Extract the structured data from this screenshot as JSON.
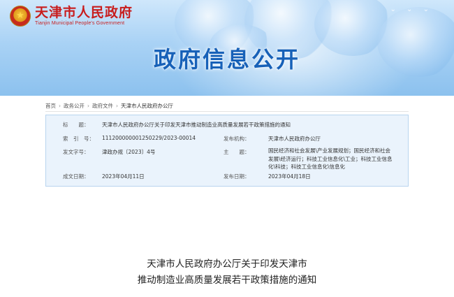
{
  "header": {
    "logo_title": "天津市人民政府",
    "logo_subtitle": "Tianjin Municipal People's Government",
    "banner_title": "政府信息公开"
  },
  "breadcrumb": [
    "首页",
    "政务公开",
    "政府文件",
    "天津市人民政府办公厅"
  ],
  "breadcrumb_separator": "›",
  "info": {
    "title_label": "标　　题：",
    "title_value": "天津市人民政府办公厅关于印发天津市推动制造业高质量发展若干政策措施的通知",
    "index_label": "索　引　号：",
    "index_value": "11120000000125022​9/2023-00014",
    "publisher_label": "发布机构：",
    "publisher_value": "天津市人民政府办公厅",
    "docno_label": "发文字号：",
    "docno_value": "津政办规〔2023〕4号",
    "subject_label": "主　　题：",
    "subject_value": "国民经济和社会发展\\产业发展规划；国民经济和社会发展\\经济运行；科技工业信息化\\工业；科技工业信息化\\科技；科技工业信息化\\信息化",
    "date_label": "成文日期：",
    "date_value": "2023年04月11日",
    "pubdate_label": "发布日期：",
    "pubdate_value": "2023年04月18日"
  },
  "article": {
    "title_line1": "天津市人民政府办公厅关于印发天津市",
    "title_line2": "推动制造业高质量发展若干政策措施的通知"
  },
  "colors": {
    "logo_red": "#c81d1d",
    "banner_title_blue": "#1761b8",
    "infobox_bg": "#eaf3fc",
    "infobox_border": "#b8d4ef"
  }
}
